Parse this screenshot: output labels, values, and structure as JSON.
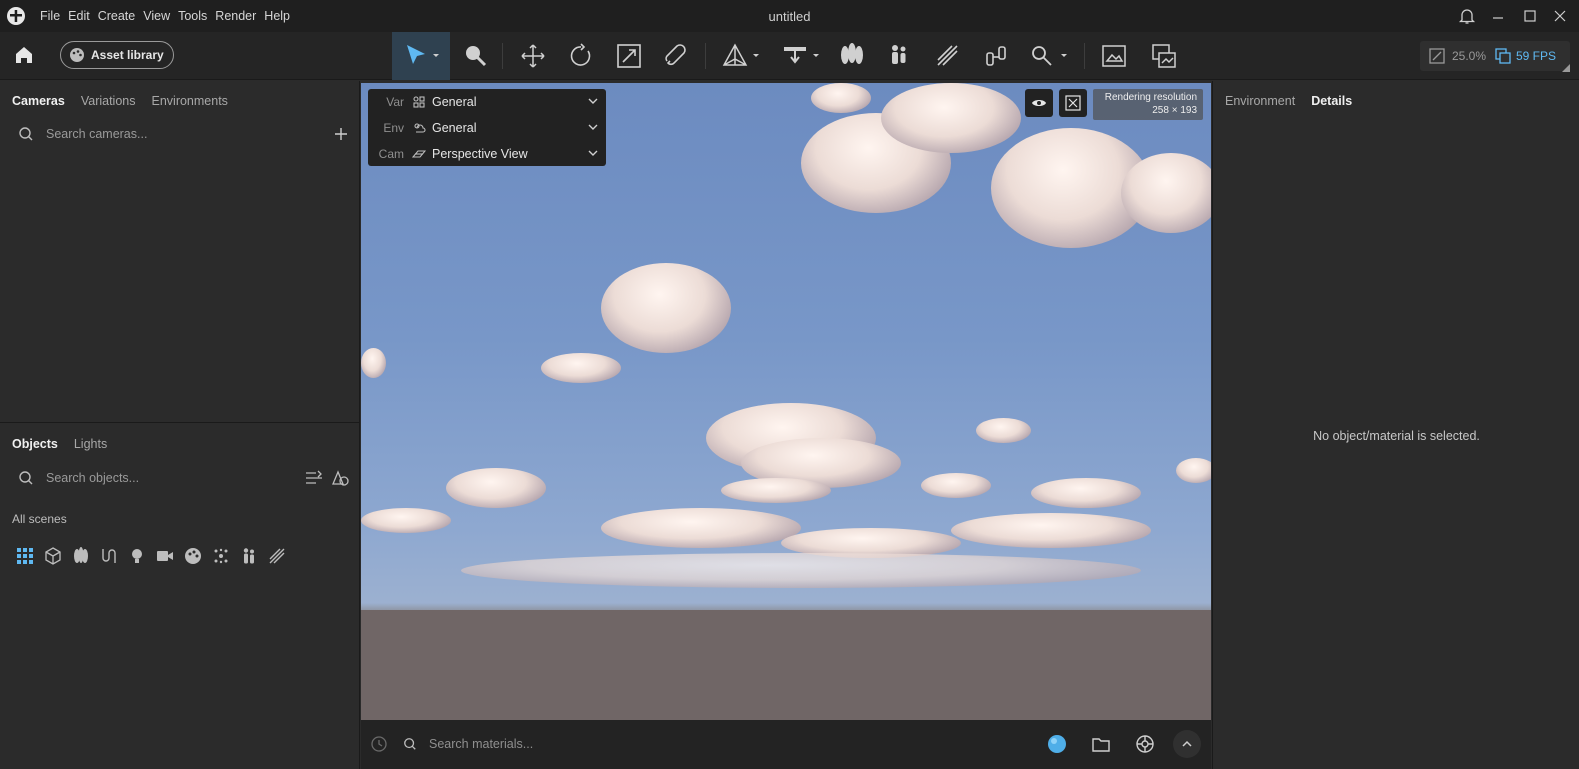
{
  "app": {
    "title": "untitled"
  },
  "menu": [
    "File",
    "Edit",
    "Create",
    "View",
    "Tools",
    "Render",
    "Help"
  ],
  "toolbar": {
    "asset_library_label": "Asset library",
    "zoom_percent": "25.0%",
    "fps": "59 FPS"
  },
  "left_panel": {
    "top_tabs": [
      {
        "label": "Cameras",
        "active": true
      },
      {
        "label": "Variations",
        "active": false
      },
      {
        "label": "Environments",
        "active": false
      }
    ],
    "camera_search_placeholder": "Search cameras...",
    "bottom_tabs": [
      {
        "label": "Objects",
        "active": true
      },
      {
        "label": "Lights",
        "active": false
      }
    ],
    "object_search_placeholder": "Search objects...",
    "all_scenes_label": "All scenes",
    "filter_icons": [
      "grid-icon",
      "cube-icon",
      "plant-icon",
      "curve-icon",
      "bulb-icon",
      "camera-icon",
      "palette-icon",
      "particles-icon",
      "people-icon",
      "lightning-icon"
    ]
  },
  "viewport": {
    "variation": {
      "label": "Var",
      "value": "General"
    },
    "environment": {
      "label": "Env",
      "value": "General"
    },
    "camera": {
      "label": "Cam",
      "value": "Perspective View"
    },
    "resolution_title": "Rendering resolution",
    "resolution_value": "258 × 193"
  },
  "bottom_bar": {
    "material_search_placeholder": "Search materials..."
  },
  "right_panel": {
    "tabs": [
      {
        "label": "Environment",
        "active": false
      },
      {
        "label": "Details",
        "active": true
      }
    ],
    "empty_message": "No object/material is selected."
  },
  "colors": {
    "accent": "#5fb9f2",
    "active_tool": "#2f4150"
  }
}
